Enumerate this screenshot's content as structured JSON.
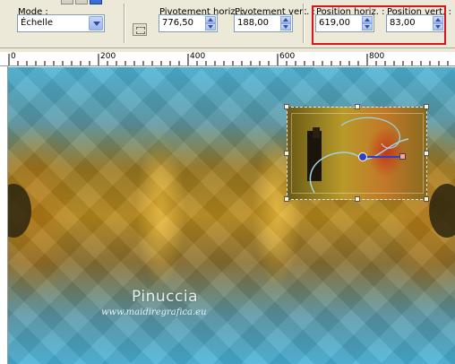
{
  "toolbar": {
    "mode_label": "Mode :",
    "mode_value": "Échelle",
    "pivot_h_label": "Pivotement horiz. :",
    "pivot_h_value": "776,50",
    "pivot_v_label": "Pivotement vert. :",
    "pivot_v_value": "188,00",
    "pos_h_label": "Position horiz. :",
    "pos_h_value": "619,00",
    "pos_v_label": "Position vert. :",
    "pos_v_value": "83,00",
    "highlight_color": "#d8161b"
  },
  "ruler": {
    "labels": [
      "0",
      "200",
      "400",
      "600",
      "800"
    ]
  },
  "watermark": {
    "title": "Pinuccia",
    "url": "www.maidiregrafica.eu"
  }
}
